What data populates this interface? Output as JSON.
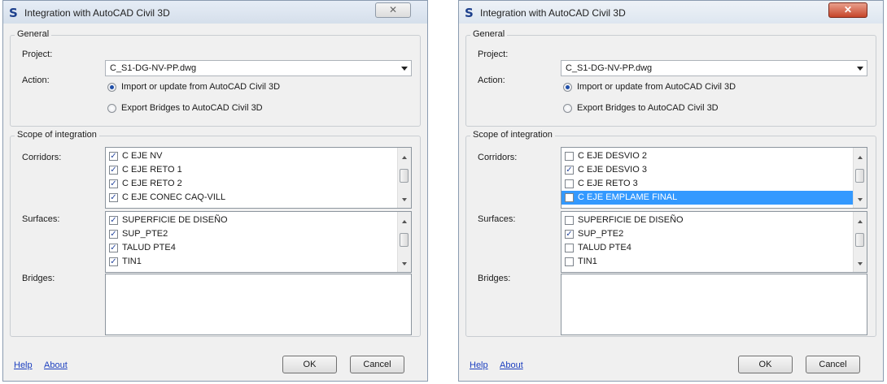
{
  "dialogs": [
    {
      "title": "Integration with AutoCAD Civil 3D",
      "app_icon": "S",
      "close_glyph": "✕",
      "general_label": "General",
      "project_label": "Project:",
      "project_value": "C_S1-DG-NV-PP.dwg",
      "action_label": "Action:",
      "radio_import": "Import or update from AutoCAD Civil 3D",
      "radio_export": "Export Bridges to AutoCAD Civil 3D",
      "scope_label": "Scope of integration",
      "corridors_label": "Corridors:",
      "corridors": [
        {
          "label": "C EJE NV",
          "checked": true,
          "selected": false
        },
        {
          "label": "C EJE RETO 1",
          "checked": true,
          "selected": false
        },
        {
          "label": "C EJE RETO 2",
          "checked": true,
          "selected": false
        },
        {
          "label": "C EJE CONEC CAQ-VILL",
          "checked": true,
          "selected": false
        }
      ],
      "surfaces_label": "Surfaces:",
      "surfaces": [
        {
          "label": "SUPERFICIE DE DISEÑO",
          "checked": true,
          "selected": false
        },
        {
          "label": "SUP_PTE2",
          "checked": true,
          "selected": false
        },
        {
          "label": "TALUD PTE4",
          "checked": true,
          "selected": false
        },
        {
          "label": "TIN1",
          "checked": true,
          "selected": false
        }
      ],
      "bridges_label": "Bridges:",
      "help_link": "Help",
      "about_link": "About",
      "ok_button": "OK",
      "cancel_button": "Cancel"
    },
    {
      "title": "Integration with AutoCAD Civil 3D",
      "app_icon": "S",
      "close_glyph": "✕",
      "general_label": "General",
      "project_label": "Project:",
      "project_value": "C_S1-DG-NV-PP.dwg",
      "action_label": "Action:",
      "radio_import": "Import or update from AutoCAD Civil 3D",
      "radio_export": "Export Bridges to AutoCAD Civil 3D",
      "scope_label": "Scope of integration",
      "corridors_label": "Corridors:",
      "corridors": [
        {
          "label": "C EJE DESVIO 2",
          "checked": false,
          "selected": false
        },
        {
          "label": "C EJE DESVIO 3",
          "checked": true,
          "selected": false
        },
        {
          "label": "C EJE RETO 3",
          "checked": false,
          "selected": false
        },
        {
          "label": "C EJE EMPLAME FINAL",
          "checked": false,
          "selected": true
        }
      ],
      "surfaces_label": "Surfaces:",
      "surfaces": [
        {
          "label": "SUPERFICIE DE DISEÑO",
          "checked": false,
          "selected": false
        },
        {
          "label": "SUP_PTE2",
          "checked": true,
          "selected": false
        },
        {
          "label": "TALUD PTE4",
          "checked": false,
          "selected": false
        },
        {
          "label": "TIN1",
          "checked": false,
          "selected": false
        }
      ],
      "bridges_label": "Bridges:",
      "help_link": "Help",
      "about_link": "About",
      "ok_button": "OK",
      "cancel_button": "Cancel"
    }
  ],
  "check_glyph": "✓"
}
